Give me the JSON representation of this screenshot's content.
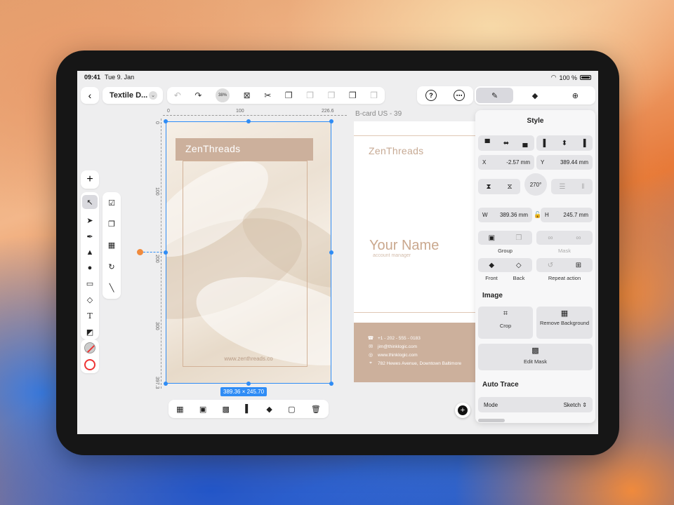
{
  "status": {
    "time": "09:41",
    "date": "Tue 9. Jan",
    "battery": "100 %"
  },
  "toolbar": {
    "document_name": "Textile D...",
    "zoom": "38%"
  },
  "rulers": {
    "h_ticks": [
      "0",
      "100",
      "226.6"
    ],
    "v_ticks": [
      "0",
      "100",
      "200",
      "300",
      "397.3"
    ]
  },
  "canvas": {
    "artboard1": {
      "brand": "ZenThreads",
      "url": "www.zenthreads.co",
      "selection_size": "389.36 × 245.70"
    },
    "artboard2": {
      "title": "B-card US - 39",
      "brand": "ZenThreads",
      "name": "Your Name",
      "role": "account manager",
      "contacts": [
        {
          "icon": "phone-icon",
          "text": "+1 - 202 - 555 - 0183"
        },
        {
          "icon": "mail-icon",
          "text": "jim@thinklogic.com"
        },
        {
          "icon": "globe-icon",
          "text": "www.thinklogic.com"
        },
        {
          "icon": "location-icon",
          "text": "782 Hewes Avenue, Downtown Baltimore"
        }
      ]
    }
  },
  "style_panel": {
    "title": "Style",
    "x_label": "X",
    "x_value": "-2.57 mm",
    "y_label": "Y",
    "y_value": "389.44 mm",
    "rotation": "270°",
    "w_label": "W",
    "w_value": "389.36 mm",
    "h_label": "H",
    "h_value": "245.7 mm",
    "group_label": "Group",
    "mask_label": "Mask",
    "front_label": "Front",
    "back_label": "Back",
    "repeat_label": "Repeat action",
    "image_heading": "Image",
    "crop_label": "Crop",
    "remove_bg_label": "Remove Background",
    "edit_mask_label": "Edit Mask",
    "auto_trace_heading": "Auto Trace",
    "mode_label": "Mode",
    "mode_value": "Sketch"
  },
  "colors": {
    "accent": "#2f8cf5",
    "brand_tan": "#ccb09c",
    "handle_orange": "#f08a3c"
  }
}
